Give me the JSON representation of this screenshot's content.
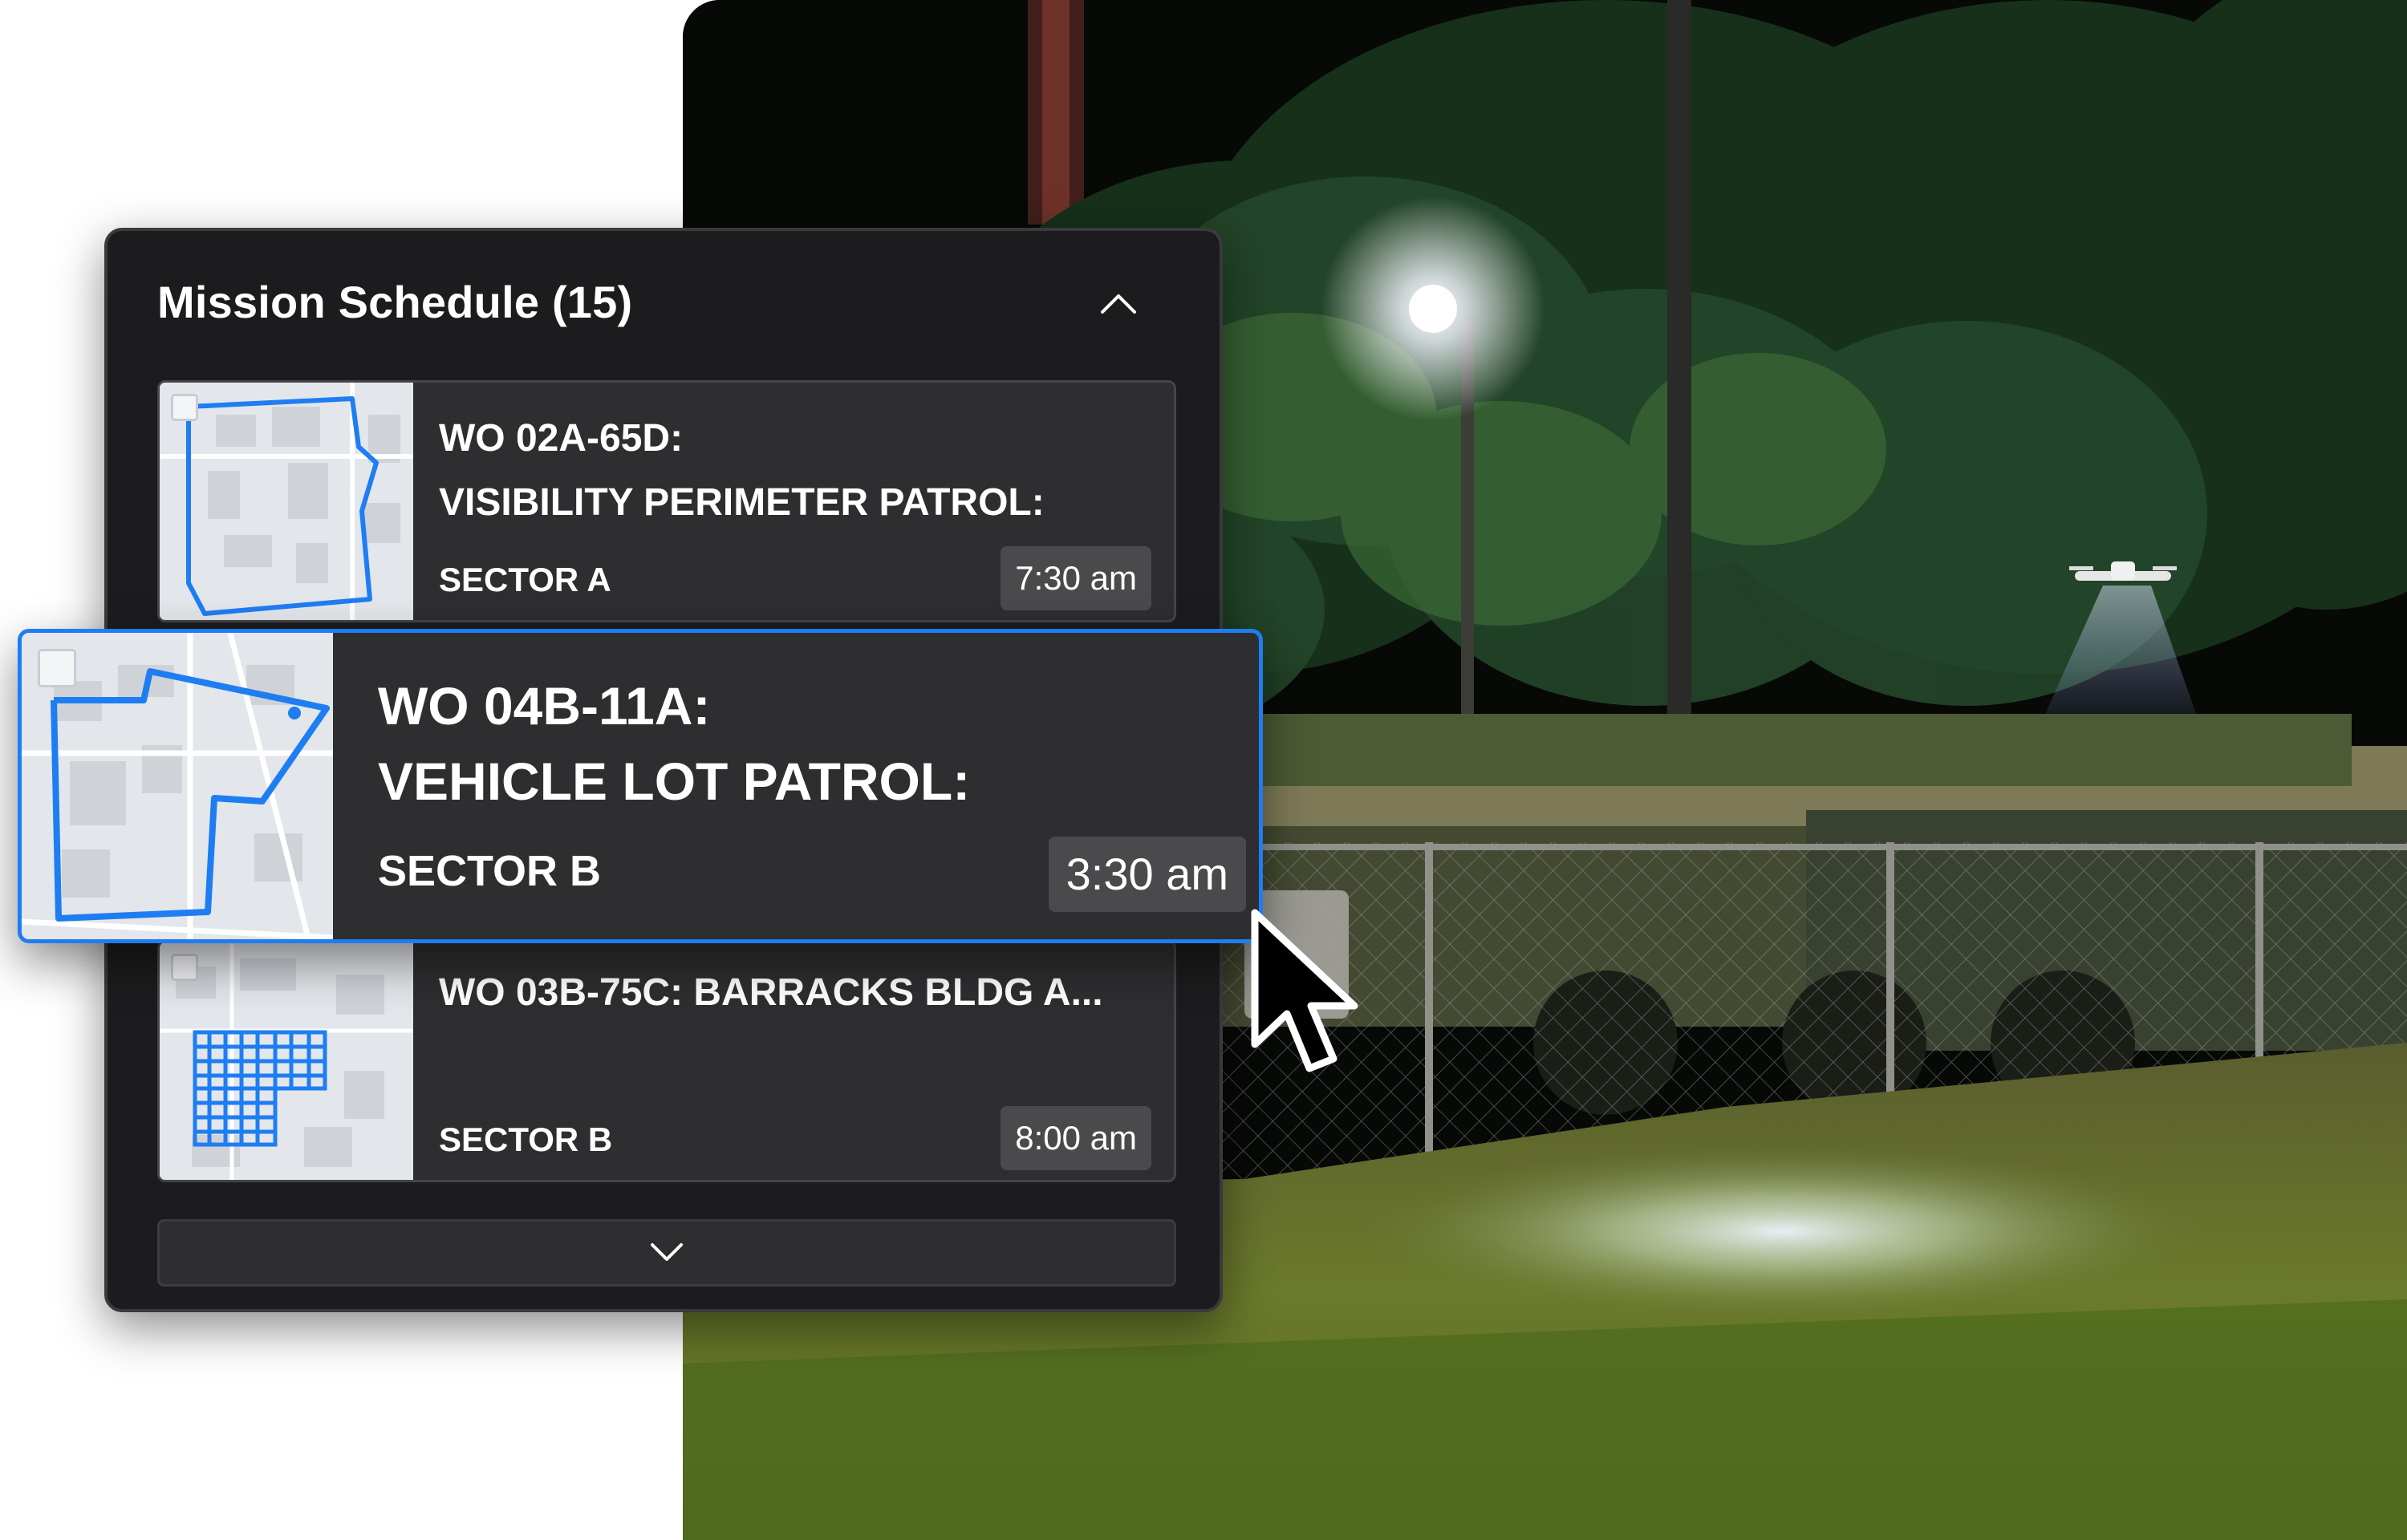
{
  "panel": {
    "title": "Mission Schedule (15)",
    "collapse_icon": "chevron-up-icon",
    "expand_icon": "chevron-down-icon"
  },
  "missions": [
    {
      "title_line1": "WO 02A-65D:",
      "title_line2": "VISIBILITY PERIMETER PATROL:",
      "sector": "SECTOR A",
      "time": "7:30 am"
    },
    {
      "title_line1": "WO 04B-11A:",
      "title_line2": "VEHICLE LOT PATROL:",
      "sector": "SECTOR B",
      "time": "3:30 am",
      "state": "selected"
    },
    {
      "title_line1": "WO 03B-75C:  BARRACKS BLDG A...",
      "sector": "SECTOR B",
      "time": "8:00 am"
    }
  ],
  "colors": {
    "accent": "#1f7df2",
    "panel_bg": "#1c1c1e",
    "card_bg": "#2e2e30",
    "badge_bg": "#4a4a4c",
    "route_line": "#1f7df2"
  },
  "icons": [
    "chevron-up-icon",
    "chevron-down-icon",
    "mouse-pointer-icon",
    "route-map-thumbnail"
  ]
}
